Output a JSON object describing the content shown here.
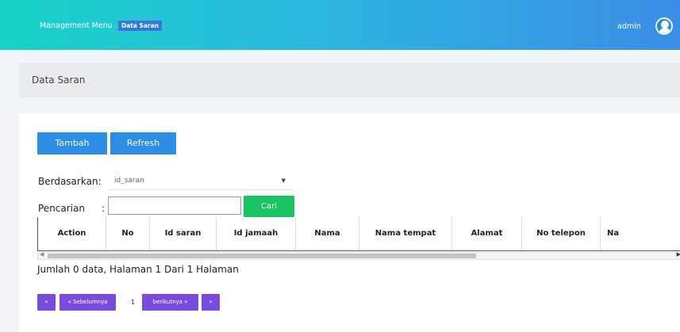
{
  "header": {
    "menu_label": "Management Menu",
    "active_badge": "Data Saran",
    "user_name": "admin"
  },
  "page": {
    "title": "Data Saran"
  },
  "toolbar": {
    "add_label": "Tambah",
    "refresh_label": "Refresh"
  },
  "filter": {
    "by_label": "Berdasarkan",
    "by_colon": ":",
    "by_selected": "id_saran",
    "search_label": "Pencarian",
    "search_colon": ":",
    "search_value": "",
    "search_button": "Cari"
  },
  "table": {
    "columns": [
      "Action",
      "No",
      "Id saran",
      "Id jamaah",
      "Nama",
      "Nama tempat",
      "Alamat",
      "No telepon",
      "Na"
    ],
    "rows": []
  },
  "summary": "Jumlah 0 data, Halaman 1 Dari 1 Halaman",
  "pagination": {
    "first": "«",
    "prev": "« Sebelumnya",
    "current": "1",
    "next": "berikutnya »",
    "last": "»"
  },
  "colors": {
    "topbar_start": "#17d3c6",
    "topbar_end": "#3b8de6",
    "primary": "#2b8de3",
    "success": "#19c562",
    "pager": "#7b4be0"
  }
}
